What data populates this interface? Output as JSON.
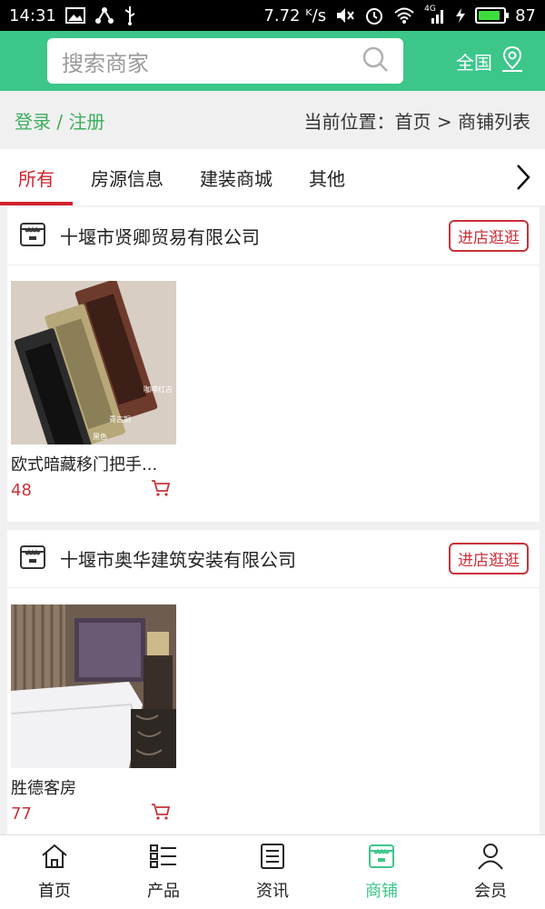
{
  "statusbar": {
    "time": "14:31",
    "speed": "7.72 ᴷ/s",
    "network": "4G",
    "battery": "87",
    "battery_level": 0.87
  },
  "header": {
    "search_placeholder": "搜索商家",
    "region": "全国"
  },
  "crumbs": {
    "login": "登录 / 注册",
    "location": "当前位置：首页 > 商铺列表"
  },
  "tabs": [
    "所有",
    "房源信息",
    "建装商城",
    "其他"
  ],
  "shops": [
    {
      "name": "十堰市贤卿贸易有限公司",
      "button": "进店逛逛",
      "product": {
        "name": "欧式暗藏移门把手...",
        "price": "48",
        "photo_labels": [
          "咖啡红古",
          "青古铜",
          "黑色"
        ]
      }
    },
    {
      "name": "十堰市奥华建筑安装有限公司",
      "button": "进店逛逛",
      "product": {
        "name": "胜德客房",
        "price": "77"
      }
    }
  ],
  "bottomnav": [
    {
      "label": "首页",
      "icon": "home-icon"
    },
    {
      "label": "产品",
      "icon": "list-icon"
    },
    {
      "label": "资讯",
      "icon": "news-icon"
    },
    {
      "label": "商铺",
      "icon": "store-icon"
    },
    {
      "label": "会员",
      "icon": "user-icon"
    }
  ],
  "colors": {
    "brand": "#3cc68a",
    "accent_red": "#d0232d",
    "login_green": "#3cae5d"
  }
}
